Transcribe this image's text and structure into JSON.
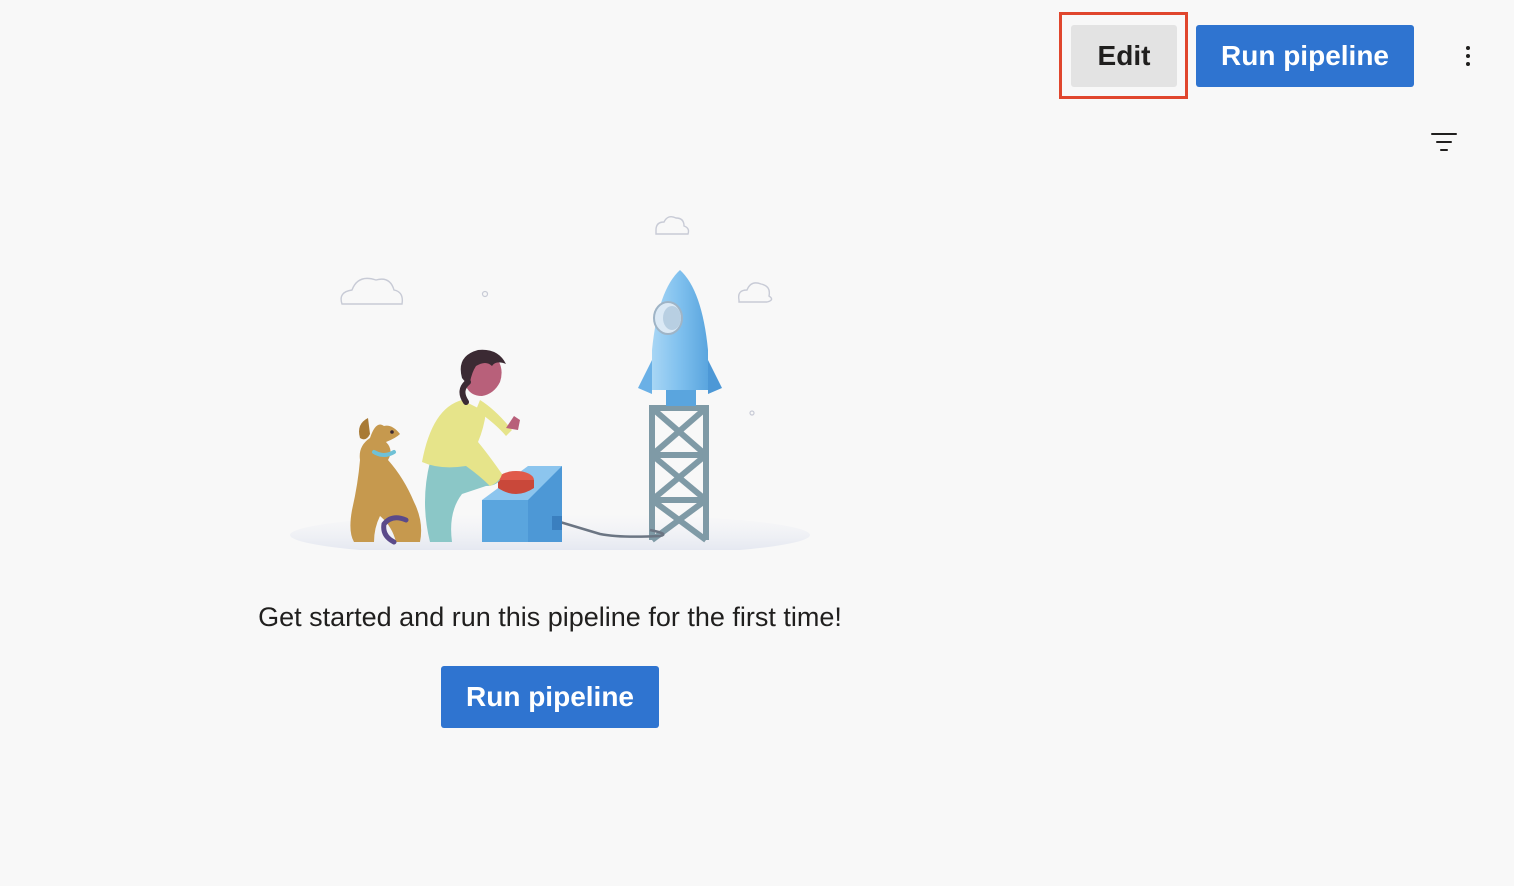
{
  "toolbar": {
    "edit_label": "Edit",
    "run_label": "Run pipeline",
    "more_icon": "more-vertical-icon",
    "filter_icon": "filter-icon"
  },
  "empty_state": {
    "message": "Get started and run this pipeline for the first time!",
    "run_label": "Run pipeline",
    "illustration": "rocket-launch-illustration"
  },
  "colors": {
    "primary": "#2f74d0",
    "highlight": "#e0462d",
    "background": "#f8f8f8",
    "secondary_button": "#e3e3e3"
  }
}
